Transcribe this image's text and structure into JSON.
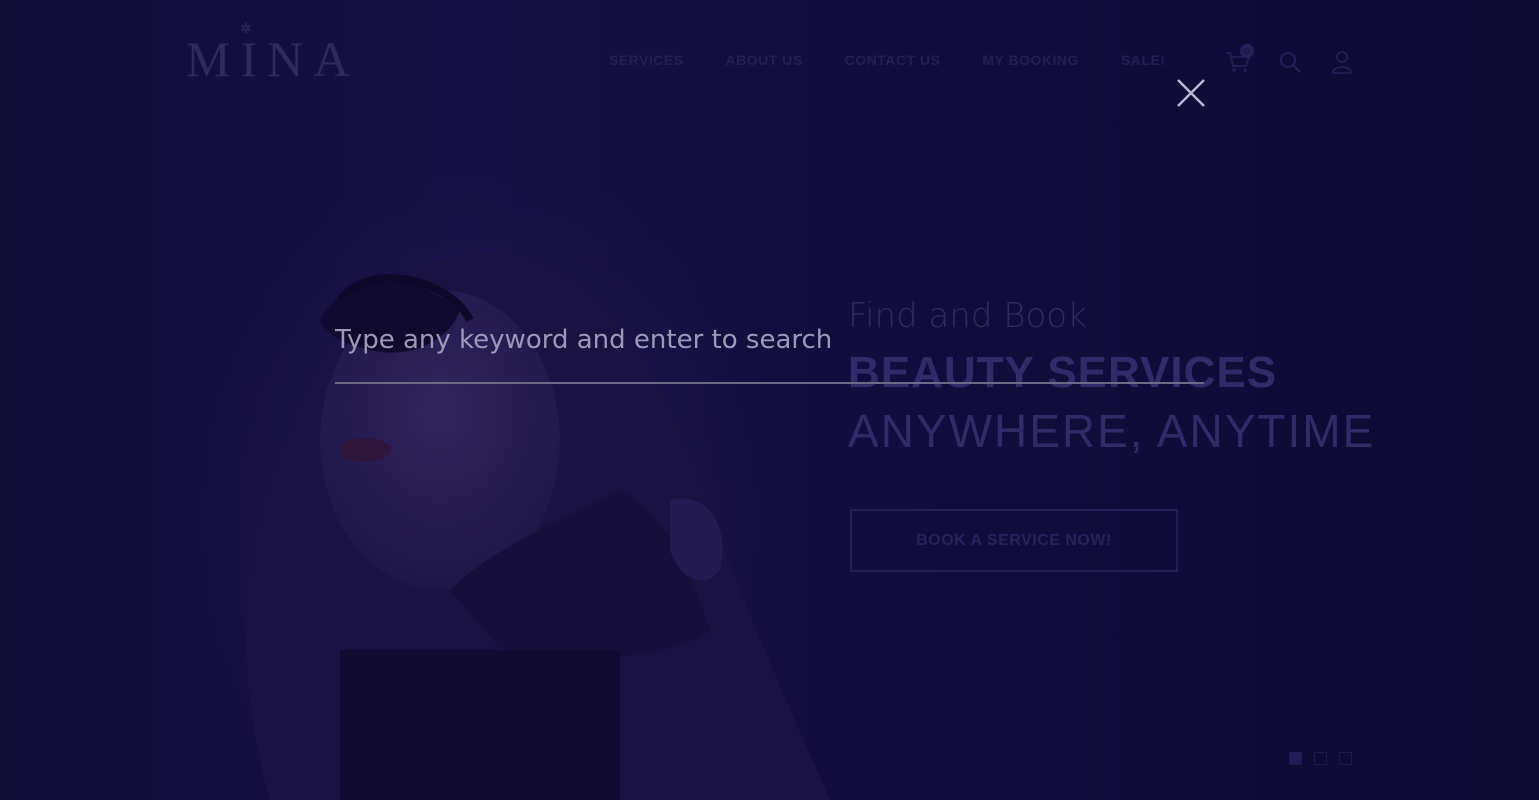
{
  "header": {
    "logo_text": "MINA",
    "nav": [
      {
        "label": "SERVICES"
      },
      {
        "label": "ABOUT US"
      },
      {
        "label": "CONTACT US"
      },
      {
        "label": "MY BOOKING"
      },
      {
        "label": "SALE!"
      }
    ],
    "cart_count": "0",
    "icons": [
      "cart-icon",
      "search-icon",
      "user-icon"
    ]
  },
  "hero": {
    "line1": "Find and Book",
    "line2": "BEAUTY SERVICES",
    "line3": "ANYWHERE, ANYTIME",
    "cta": "BOOK A SERVICE NOW!",
    "slides": 3,
    "active_slide": 1
  },
  "search_overlay": {
    "placeholder": "Type any keyword and enter to search",
    "value": "",
    "close_icon": "close-icon"
  },
  "colors": {
    "background": "#0d0a2c",
    "overlay_text": "#9b99b8",
    "underline": "#6c6a86"
  }
}
